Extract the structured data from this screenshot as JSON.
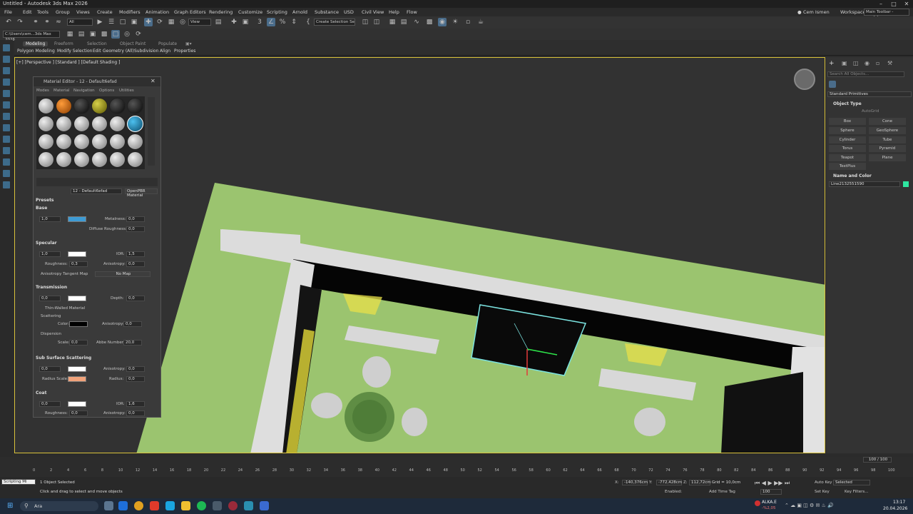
{
  "window": {
    "title": "Untitled - Autodesk 3ds Max 2026"
  },
  "menu": [
    "File",
    "Edit",
    "Tools",
    "Group",
    "Views",
    "Create",
    "Modifiers",
    "Animation",
    "Graph Editors",
    "Rendering",
    "Customize",
    "Scripting",
    "Arnold",
    "Substance",
    "USD",
    "Civil View",
    "Help",
    "Flow"
  ],
  "user": {
    "name": "Cem Ismen",
    "workspaces_label": "Workspaces:",
    "workspace": "Main Toolbar - modular"
  },
  "toolbar": {
    "selection_filter": "All",
    "ref_coord": "View",
    "named_selection": "Create Selection Se",
    "project_path": "C:\\Users\\cem...3ds Max 2026"
  },
  "ribbon": {
    "tabs": [
      "Modeling",
      "Freeform",
      "Selection",
      "Object Paint",
      "Populate"
    ],
    "active_tab": "Modeling",
    "subtabs": [
      "Polygon Modeling",
      "Modify Selection",
      "Edit",
      "Geometry (All)",
      "Subdivision",
      "Align",
      "Properties"
    ]
  },
  "viewport": {
    "label": "[+] [Perspective ] [Standard ] [Default Shading ]"
  },
  "material_editor": {
    "title": "Material Editor - 12 - Default6efad",
    "menu": [
      "Modes",
      "Material",
      "Navigation",
      "Options",
      "Utilities"
    ],
    "material_name": "12 - Default6efad",
    "material_type": "OpenPBR Material",
    "sections": {
      "presets": "Presets",
      "base": "Base",
      "specular": "Specular",
      "transmission": "Transmission",
      "sss": "Sub Surface Scattering",
      "coat": "Coat"
    },
    "base": {
      "weight": "1,0",
      "metalness_label": "Metalness:",
      "metalness": "0,0",
      "diffuse_roughness_label": "Diffuse Roughness:",
      "diffuse_roughness": "0,0",
      "color": "#3d9bd4"
    },
    "specular": {
      "weight": "1,0",
      "ior_label": "IOR:",
      "ior": "1,5",
      "roughness_label": "Roughness:",
      "roughness": "0,3",
      "anisotropy_label": "Anisotropy:",
      "anisotropy": "0,0",
      "tangent_label": "Anisotropy Tangent Map",
      "no_map": "No Map"
    },
    "transmission": {
      "weight": "0,0",
      "depth_label": "Depth:",
      "depth": "0,0",
      "thin_walled": "Thin-Walled Material",
      "scattering": "Scattering",
      "color_label": "Color:",
      "anisotropy_label": "Anisotropy:",
      "anisotropy": "0,0",
      "dispersion": "Dispersion",
      "scale_label": "Scale:",
      "scale": "0,0",
      "abbe_label": "Abbe Number:",
      "abbe": "20,0"
    },
    "sss": {
      "weight": "0,0",
      "anisotropy_label": "Anisotropy:",
      "anisotropy": "0,0",
      "radius_scale_label": "Radius Scale:",
      "radius_label": "Radius:",
      "radius": "0,0"
    },
    "coat": {
      "weight": "0,0",
      "ior_label": "IOR:",
      "ior": "1,6",
      "roughness_label": "Roughness:",
      "roughness": "0,0",
      "anisotropy_label": "Anisotropy:",
      "anisotropy": "0,0"
    }
  },
  "command_panel": {
    "search_placeholder": "Search All Objects...",
    "category": "Standard Primitives",
    "object_type": "Object Type",
    "autogrid": "AutoGrid",
    "primitives": [
      "Box",
      "Cone",
      "Sphere",
      "GeoSphere",
      "Cylinder",
      "Tube",
      "Torus",
      "Pyramid",
      "Teapot",
      "Plane",
      "TextPlus"
    ],
    "name_and_color": "Name and Color",
    "object_name": "Line2132551590",
    "object_color": "#2ee6a0"
  },
  "timeline": {
    "frame_counter": "100 / 100",
    "ticks": [
      "0",
      "2",
      "4",
      "6",
      "8",
      "10",
      "12",
      "14",
      "16",
      "18",
      "20",
      "22",
      "24",
      "26",
      "28",
      "30",
      "32",
      "34",
      "36",
      "38",
      "40",
      "42",
      "44",
      "46",
      "48",
      "50",
      "52",
      "54",
      "56",
      "58",
      "60",
      "62",
      "64",
      "66",
      "68",
      "70",
      "72",
      "74",
      "76",
      "78",
      "80",
      "82",
      "84",
      "86",
      "88",
      "90",
      "92",
      "94",
      "96",
      "98",
      "100"
    ]
  },
  "status": {
    "selected": "1 Object Selected",
    "hint": "Click and drag to select and move objects",
    "x_label": "X:",
    "x": "-140,376cm",
    "y_label": "Y:",
    "y": "-772,428cm",
    "z_label": "Z:",
    "z": "112,72cm",
    "grid": "Grid = 10,0cm",
    "enabled": "Enabled:",
    "add_time_tag": "Add Time Tag",
    "auto_key": "Auto Key",
    "set_key": "Set Key",
    "key_mode": "Selected",
    "key_filters": "Key Filters...",
    "frame": "100",
    "maxscript": "Scripting Mi"
  },
  "taskbar": {
    "search": "Ara",
    "stock_name": "ALKA.E",
    "stock_change": "-%2,05",
    "time": "13:17",
    "date": "20.04.2026"
  }
}
